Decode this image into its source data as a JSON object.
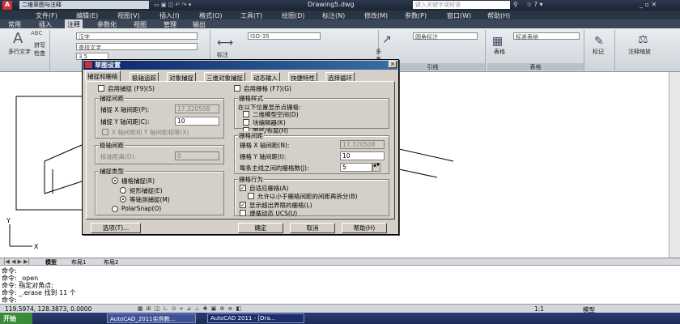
{
  "app": {
    "quick_access": "二维草图与注释",
    "filename": "Drawing5.dwg",
    "search_placeholder": "键入关键字或短语"
  },
  "menu": [
    "文件(F)",
    "编辑(E)",
    "视图(V)",
    "插入(I)",
    "格式(O)",
    "工具(T)",
    "绘图(D)",
    "标注(N)",
    "修改(M)",
    "参数(P)",
    "窗口(W)",
    "帮助(H)"
  ],
  "ribbon_tabs": [
    "常用",
    "插入",
    "注释",
    "参数化",
    "视图",
    "管理",
    "输出"
  ],
  "active_ribbon_tab": "注释",
  "ribbon": {
    "mtext": "多行文字",
    "spell": "拼写检查",
    "find": "查找文字",
    "text_style": "汉字",
    "text_height": "3.5",
    "text_search": "查找文字",
    "dim_label": "标注",
    "dim_style": "ISO-35",
    "multileader": "多重引线",
    "leader_label": "引线",
    "leader_style": "圆角标注",
    "table_label": "表格",
    "table_style": "标准表格",
    "table_group": "表格",
    "markup": "标记",
    "annoscale": "注释缩放"
  },
  "dialog": {
    "title": "草图设置",
    "close": "×",
    "tabs": [
      "捕捉和栅格",
      "极轴追踪",
      "对象捕捉",
      "三维对象捕捉",
      "动态输入",
      "快捷特性",
      "选择循环"
    ],
    "snap_on": "启用捕捉 (F9)(S)",
    "grid_on": "启用栅格 (F7)(G)",
    "snap_spacing": {
      "title": "捕捉间距",
      "x_label": "捕捉 X 轴间距(P):",
      "x_value": "17.320508",
      "y_label": "捕捉 Y 轴间距(C):",
      "y_value": "10",
      "equal": "X 轴间距和 Y 轴间距相等(X)"
    },
    "polar_spacing": {
      "title": "极轴间距",
      "label": "极轴距离(D):",
      "value": "0"
    },
    "snap_type": {
      "title": "捕捉类型",
      "grid_snap": "栅格捕捉(R)",
      "rect": "矩形捕捉(E)",
      "iso": "等轴测捕捉(M)",
      "polar": "PolarSnap(O)"
    },
    "grid_style": {
      "title": "栅格样式",
      "desc": "在以下位置显示点栅格:",
      "model": "二维模型空间(D)",
      "block": "块编辑器(K)",
      "sheet": "图纸/布局(H)"
    },
    "grid_spacing": {
      "title": "栅格间距",
      "x_label": "栅格 X 轴间距(N):",
      "x_value": "17.320508",
      "y_label": "栅格 Y 轴间距(I):",
      "y_value": "10",
      "major_label": "每条主线之间的栅格数(J):",
      "major_value": "5"
    },
    "grid_behavior": {
      "title": "栅格行为",
      "adaptive": "自适应栅格(A)",
      "subdivide": "允许以小于栅格间距的间距再拆分(B)",
      "beyond": "显示超出界限的栅格(L)",
      "ucs": "遵循动态 UCS(U)"
    },
    "buttons": {
      "options": "选项(T)...",
      "ok": "确定",
      "cancel": "取消",
      "help": "帮助(H)"
    }
  },
  "layout_tabs": [
    "模型",
    "布局1",
    "布局2"
  ],
  "command_lines": [
    "命令:",
    "命令:  _open",
    "命令:  指定对角点:",
    "命令:  _.erase 找到 11 个",
    "命令:"
  ],
  "status": {
    "coords": "119.5974, 128.3873, 0.0000",
    "model": "模型",
    "scale": "1:1"
  },
  "taskbar": {
    "start": "开始",
    "items": [
      "AutoCAD_2011实例教...",
      "AutoCAD 2011 - [Dra..."
    ]
  }
}
